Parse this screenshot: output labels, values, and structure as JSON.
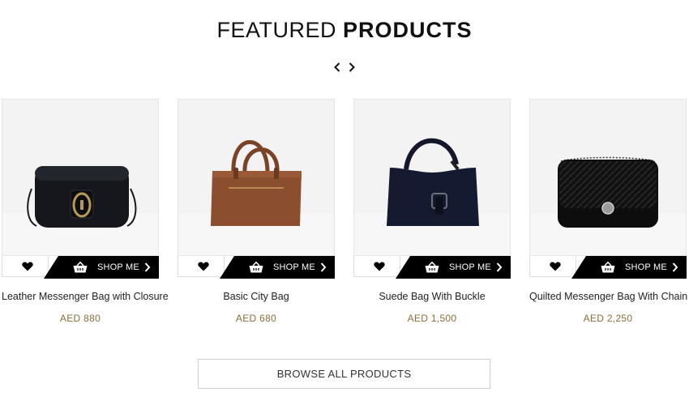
{
  "section": {
    "title_light": "FEATURED",
    "title_bold": "PRODUCTS"
  },
  "carousel": {
    "prev_icon": "chevron-left-icon",
    "next_icon": "chevron-right-icon"
  },
  "products": [
    {
      "name": "Leather Messenger Bag with Closure",
      "price": "AED 880",
      "shop_label": "SHOP ME"
    },
    {
      "name": "Basic City Bag",
      "price": "AED 680",
      "shop_label": "SHOP ME"
    },
    {
      "name": "Suede Bag With Buckle",
      "price": "AED 1,500",
      "shop_label": "SHOP ME"
    },
    {
      "name": "Quilted Messenger Bag With Chain",
      "price": "AED 2,250",
      "shop_label": "SHOP ME"
    }
  ],
  "browse_label": "BROWSE ALL PRODUCTS",
  "colors": {
    "price": "#8a6d3b",
    "shop_bar": "#000000"
  }
}
